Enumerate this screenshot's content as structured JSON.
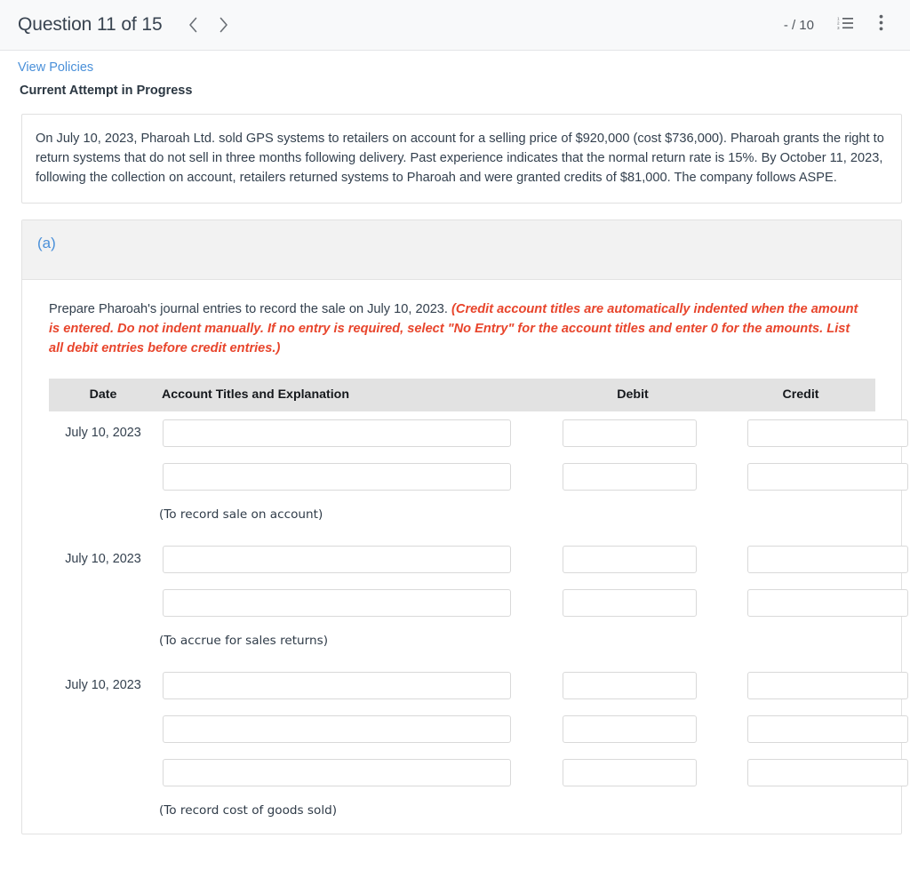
{
  "header": {
    "title": "Question 11 of 15",
    "prev_label": "Previous question",
    "next_label": "Next question",
    "score": "- / 10",
    "list_icon": "numbered-list-icon",
    "menu_icon": "kebab-menu-icon"
  },
  "links": {
    "view_policies": "View Policies"
  },
  "status": {
    "attempt": "Current Attempt in Progress"
  },
  "problem": {
    "text": "On July 10, 2023, Pharoah Ltd. sold GPS systems to retailers on account for a selling price of $920,000 (cost $736,000). Pharoah grants the right to return systems that do not sell in three months following delivery. Past experience indicates that the normal return rate is 15%. By October 11, 2023, following the collection on account, retailers returned systems to Pharoah and were granted credits of $81,000. The company follows ASPE."
  },
  "part": {
    "letter": "(a)",
    "prompt": "Prepare Pharoah's journal entries to record the sale on July 10, 2023.",
    "hint": "(Credit account titles are automatically indented when the amount is entered. Do not indent manually. If no entry is required, select \"No Entry\" for the account titles and enter 0 for the amounts. List all debit entries before credit entries.)"
  },
  "table": {
    "headers": [
      "Date",
      "Account Titles and Explanation",
      "Debit",
      "Credit"
    ],
    "entries": [
      {
        "date": "July 10, 2023",
        "lines": [
          {
            "account": "",
            "debit": "",
            "credit": ""
          },
          {
            "account": "",
            "debit": "",
            "credit": ""
          }
        ],
        "note": "(To record sale on account)"
      },
      {
        "date": "July 10, 2023",
        "lines": [
          {
            "account": "",
            "debit": "",
            "credit": ""
          },
          {
            "account": "",
            "debit": "",
            "credit": ""
          }
        ],
        "note": "(To accrue for sales returns)"
      },
      {
        "date": "July 10, 2023",
        "lines": [
          {
            "account": "",
            "debit": "",
            "credit": ""
          },
          {
            "account": "",
            "debit": "",
            "credit": ""
          },
          {
            "account": "",
            "debit": "",
            "credit": ""
          }
        ],
        "note": "(To record cost of goods sold)"
      }
    ]
  },
  "colors": {
    "link": "#4a90d9",
    "hint": "#e8452c",
    "header_bg": "#f8f9fa",
    "table_header_bg": "#e2e2e2"
  }
}
